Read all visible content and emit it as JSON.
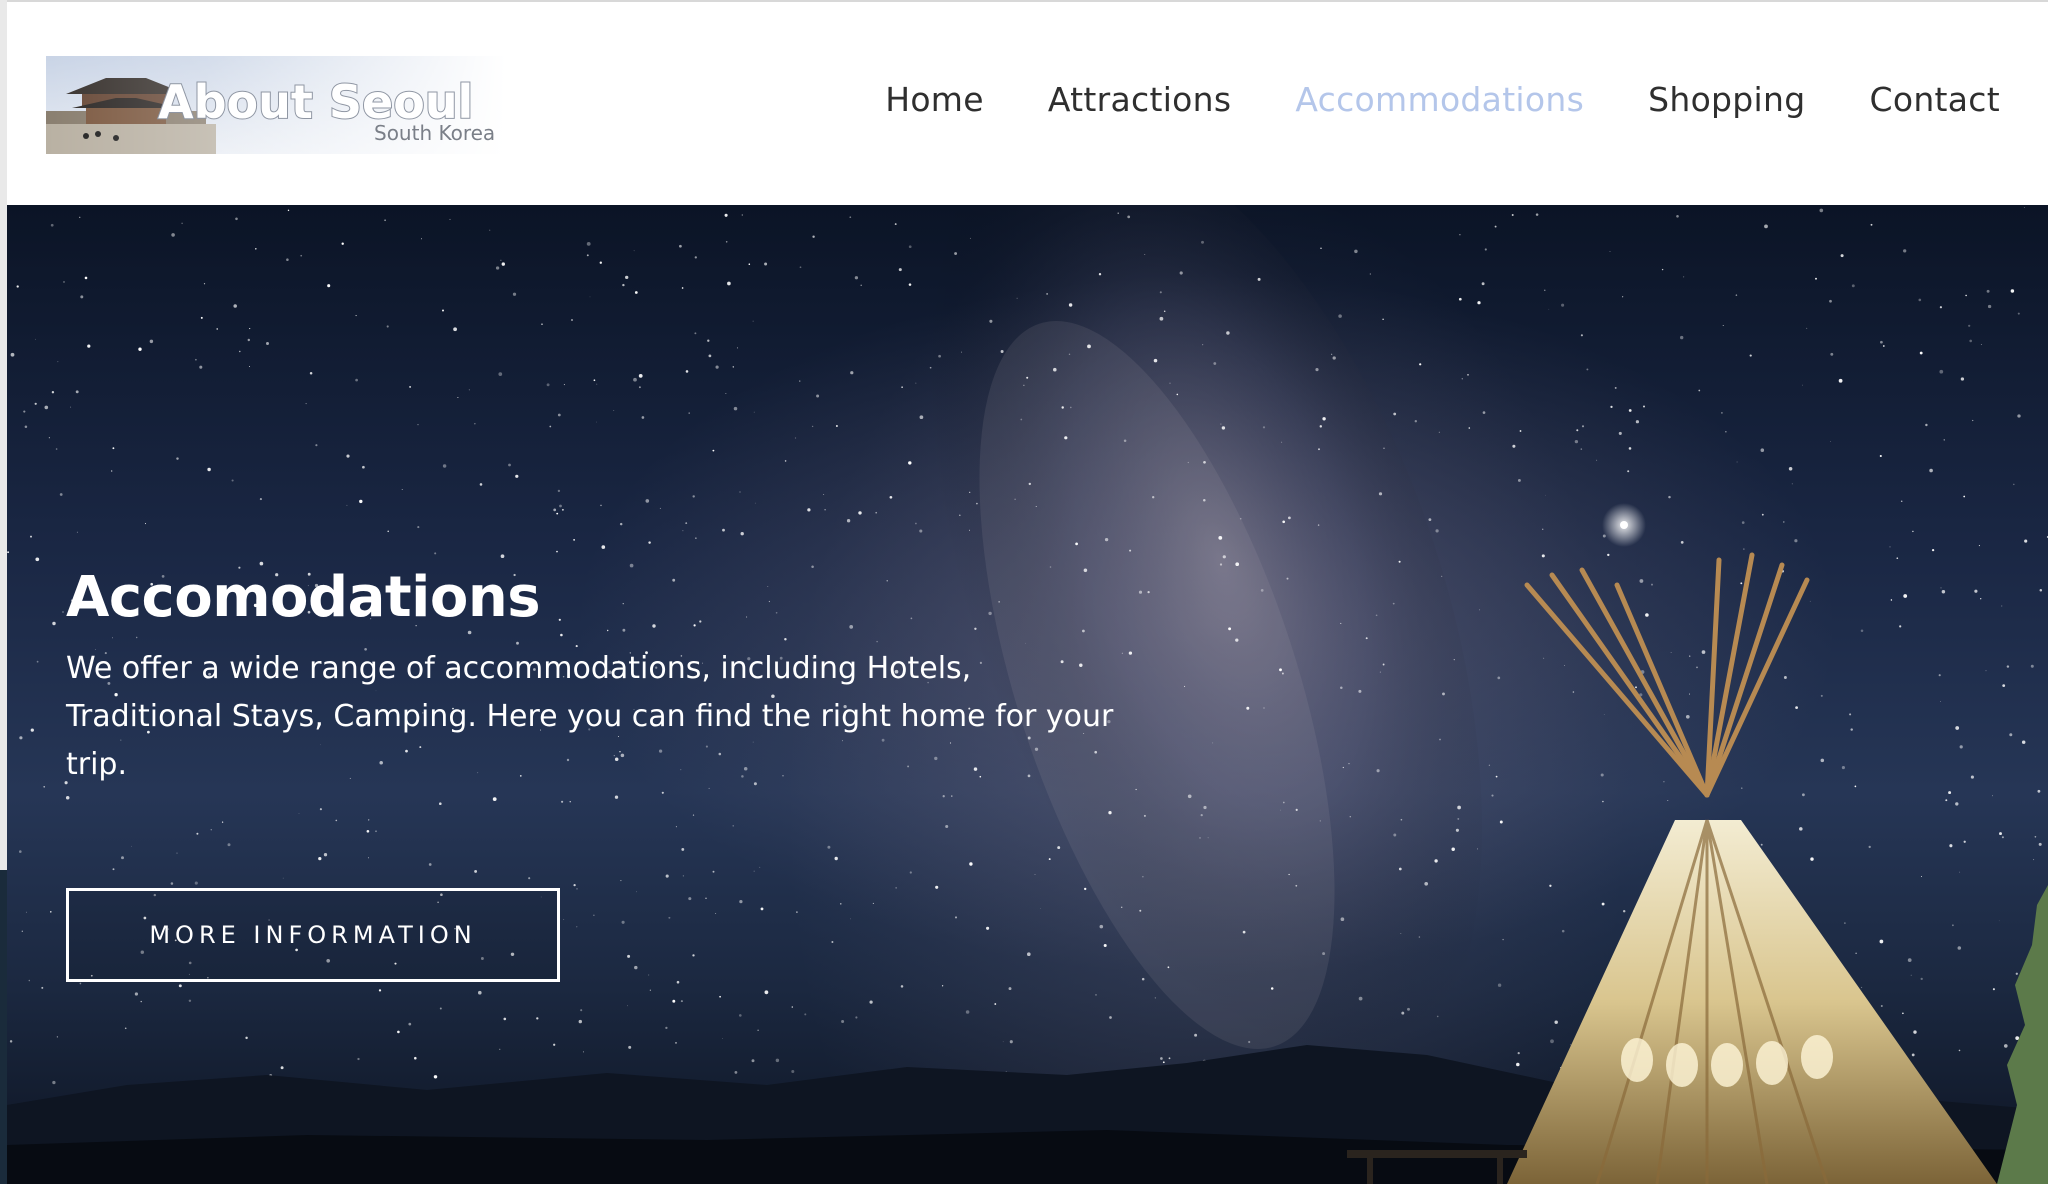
{
  "header": {
    "logo": {
      "title": "About Seoul",
      "subtitle": "South Korea"
    },
    "nav": [
      {
        "label": "Home",
        "active": false
      },
      {
        "label": "Attractions",
        "active": false
      },
      {
        "label": "Accommodations",
        "active": true
      },
      {
        "label": "Shopping",
        "active": false
      },
      {
        "label": "Contact",
        "active": false
      }
    ],
    "active_color": "#b4c6ea",
    "text_color": "#2f2f2f"
  },
  "hero": {
    "title": "Accomodations",
    "description": "We offer a wide range of accommodations, including Hotels, Traditional Stays, Camping. Here you can find the right home for your trip.",
    "button_label": "MORE INFORMATION",
    "background": "night-sky-milky-way-teepee"
  }
}
